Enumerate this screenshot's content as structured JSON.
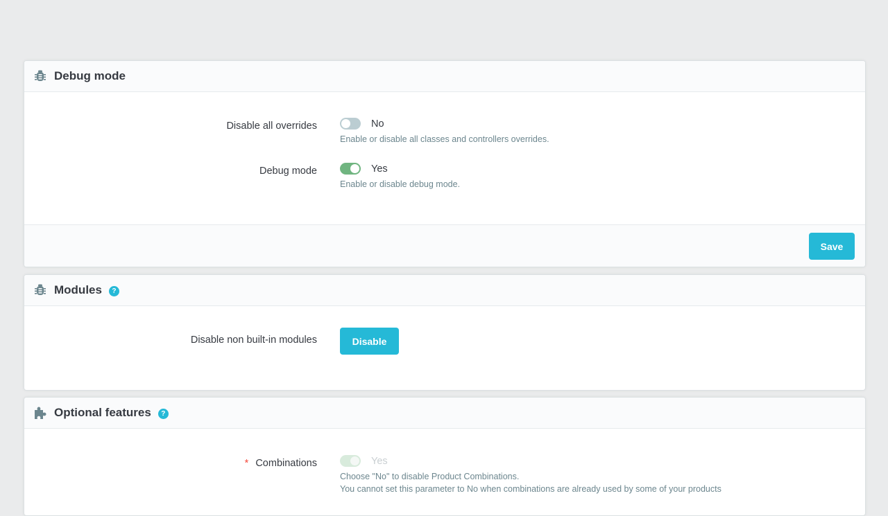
{
  "debug_card": {
    "title": "Debug mode",
    "icon": "bug-icon",
    "fields": [
      {
        "label": "Disable all overrides",
        "toggle_state": "off",
        "value": "No",
        "help": "Enable or disable all classes and controllers overrides."
      },
      {
        "label": "Debug mode",
        "toggle_state": "on",
        "value": "Yes",
        "help": "Enable or disable debug mode."
      }
    ],
    "save_label": "Save"
  },
  "modules_card": {
    "title": "Modules",
    "icon": "bug-icon",
    "help_icon": "?",
    "field_label": "Disable non built-in modules",
    "button_label": "Disable"
  },
  "features_card": {
    "title": "Optional features",
    "icon": "puzzle-icon",
    "help_icon": "?",
    "field": {
      "required_mark": "*",
      "label": "Combinations",
      "toggle_state": "on-disabled",
      "value": "Yes",
      "help_lines": [
        "Choose \"No\" to disable Product Combinations.",
        "You cannot set this parameter to No when combinations are already used by some of your products"
      ]
    }
  },
  "colors": {
    "primary": "#25b9d7",
    "toggle_on": "#70b580",
    "toggle_off": "#bbcdd2",
    "required": "#f54c3e"
  }
}
